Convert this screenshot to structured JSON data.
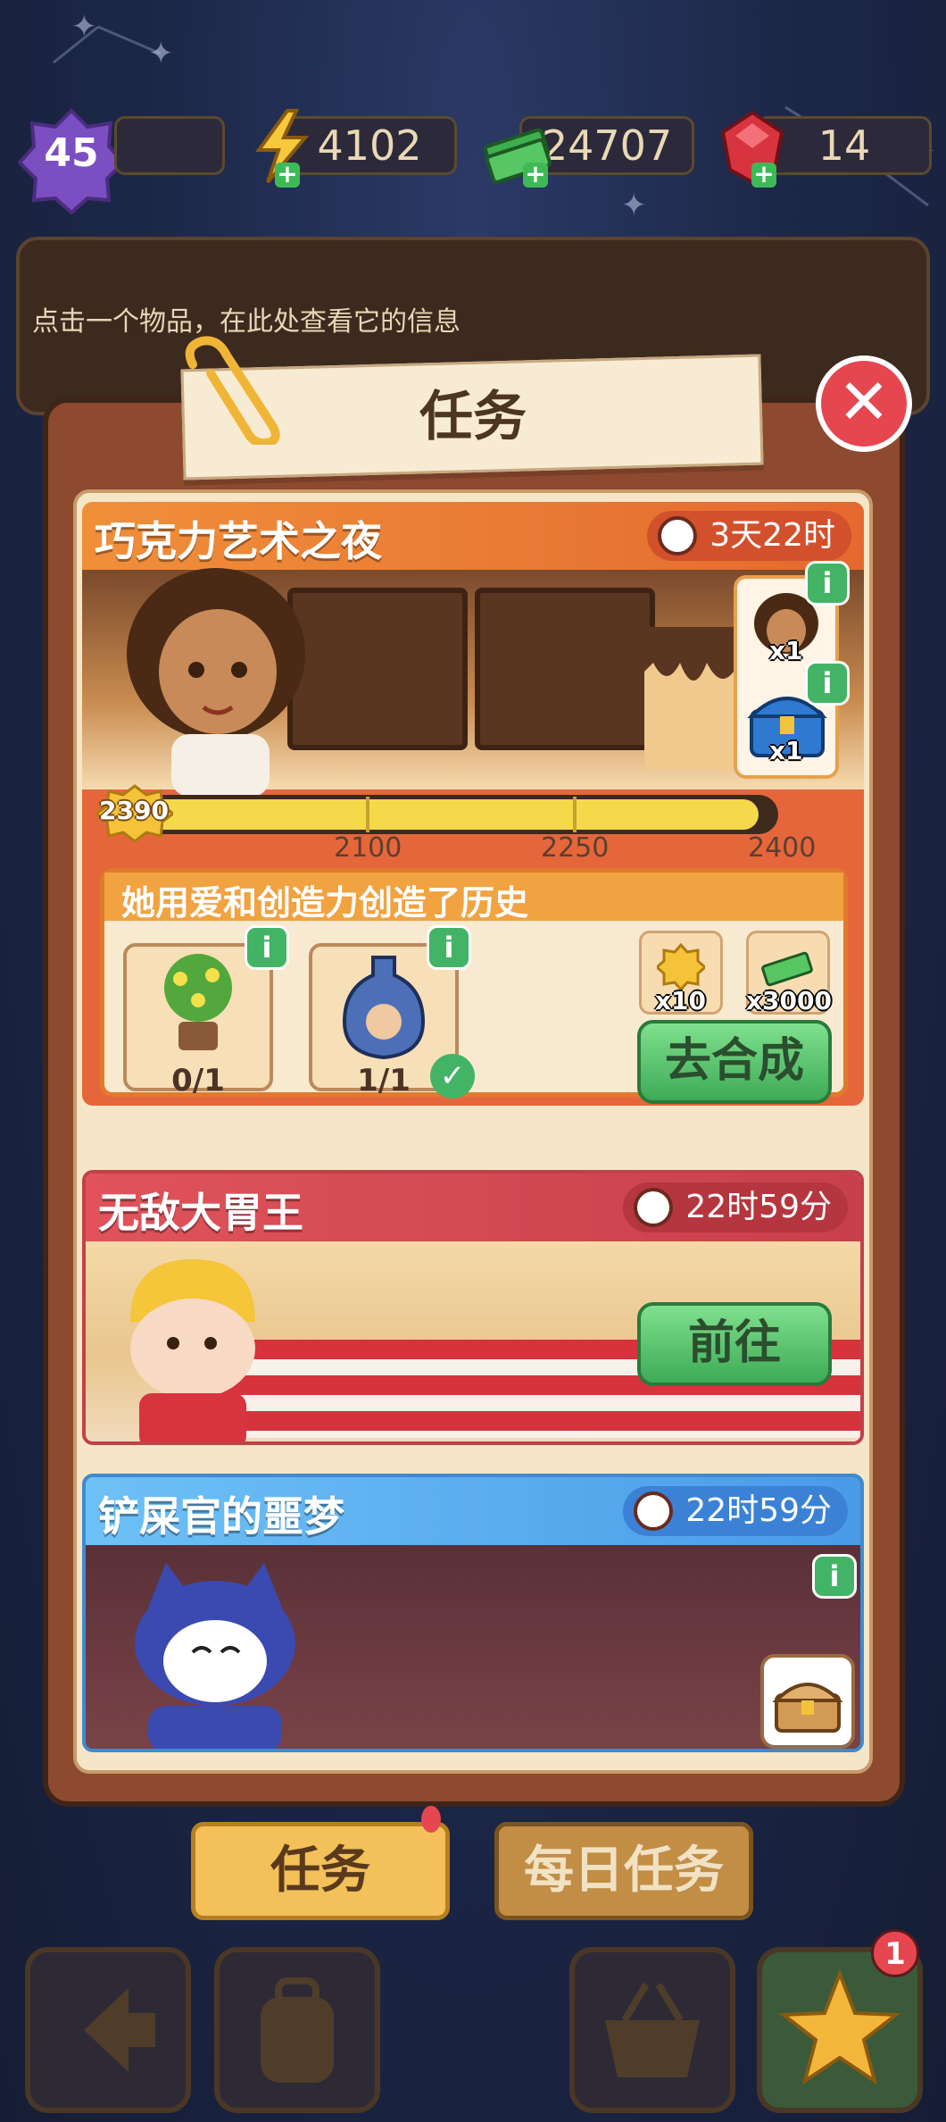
{
  "hud": {
    "level": "45",
    "energy": "4102",
    "cash": "24707",
    "gems": "14"
  },
  "info_panel": {
    "hint": "点击一个物品，在此处查看它的信息"
  },
  "panel": {
    "title": "任务"
  },
  "quests": [
    {
      "title": "巧克力艺术之夜",
      "timer": "3天22时",
      "score": "2390",
      "progress": {
        "current": 2390,
        "min": 1950,
        "max": 2400
      },
      "milestones": [
        "2100",
        "2250",
        "2400"
      ],
      "side_rewards": [
        "x1",
        "x1"
      ],
      "description": "她用爱和创造力创造了历史",
      "requirements": [
        {
          "icon": "potted-plant-icon",
          "count": "0/1",
          "done": false
        },
        {
          "icon": "vase-icon",
          "count": "1/1",
          "done": true
        }
      ],
      "rewards": [
        {
          "icon": "coin-flower-icon",
          "amount": "x10"
        },
        {
          "icon": "cash-stack-icon",
          "amount": "x3000"
        }
      ],
      "action": "去合成",
      "color": "#f0913a"
    },
    {
      "title": "无敌大胃王",
      "timer": "22时59分",
      "action": "前往",
      "color": "#d9444a"
    },
    {
      "title": "铲屎官的噩梦",
      "timer": "22时59分",
      "color": "#5aaaf0"
    }
  ],
  "tabs": {
    "active": "任务",
    "daily": "每日任务",
    "active_badge": ""
  },
  "bottom_bar": {
    "notification_count": "1"
  },
  "colors": {
    "panel_brown": "#8d4a2f",
    "cream": "#f5e6c8",
    "accent_green": "#43b466",
    "close_red": "#e64650"
  }
}
